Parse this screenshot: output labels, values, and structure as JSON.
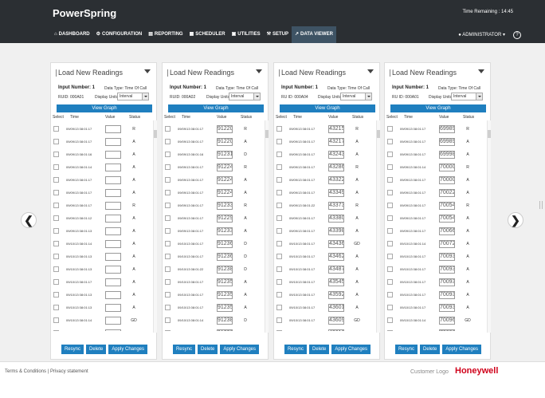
{
  "header": {
    "brand": "PowerSpring",
    "time_remaining": "Time Remaining : 14:45",
    "nav": [
      {
        "label": "DASHBOARD",
        "icon": "home-icon"
      },
      {
        "label": "CONFIGURATION",
        "icon": "gear-icon"
      },
      {
        "label": "REPORTING",
        "icon": "report-icon"
      },
      {
        "label": "SCHEDULER",
        "icon": "calendar-icon"
      },
      {
        "label": "UTILITIES",
        "icon": "briefcase-icon"
      },
      {
        "label": "SETUP",
        "icon": "wrench-icon"
      },
      {
        "label": "DATA VIEWER",
        "icon": "chart-icon"
      }
    ],
    "active_nav": "DATA VIEWER",
    "user": "ADMINISTRATOR",
    "user_caret": "▾"
  },
  "panels": [
    {
      "title": "Load New Readings",
      "input_number_label": "Input Number: 1",
      "data_type": "Data Type: Time Of Call",
      "rtu_id": "RUID: 000A01",
      "display_units_label": "Display Units:",
      "display_units": "Interval",
      "view_graph": "View Graph",
      "headers": {
        "select": "Select",
        "time": "Time",
        "value": "Value",
        "status": "Status"
      },
      "rows": [
        {
          "time": "09/09/13 08:01:17",
          "value": "",
          "status": "R"
        },
        {
          "time": "09/09/13 08:01:17",
          "value": "",
          "status": "A"
        },
        {
          "time": "09/09/13 08:01:16",
          "value": "",
          "status": "A"
        },
        {
          "time": "09/09/13 08:01:14",
          "value": "",
          "status": "A"
        },
        {
          "time": "09/09/13 08:01:17",
          "value": "",
          "status": "A"
        },
        {
          "time": "09/09/13 08:01:17",
          "value": "",
          "status": "A"
        },
        {
          "time": "09/09/13 08:01:17",
          "value": "",
          "status": "R"
        },
        {
          "time": "09/09/13 08:01:12",
          "value": "",
          "status": "A"
        },
        {
          "time": "09/09/13 08:01:13",
          "value": "",
          "status": "A"
        },
        {
          "time": "09/10/13 08:01:14",
          "value": "",
          "status": "A"
        },
        {
          "time": "09/10/13 08:01:13",
          "value": "",
          "status": "A"
        },
        {
          "time": "09/10/13 08:01:13",
          "value": "",
          "status": "A"
        },
        {
          "time": "09/10/13 08:01:17",
          "value": "",
          "status": "A"
        },
        {
          "time": "09/10/13 08:01:13",
          "value": "",
          "status": "A"
        },
        {
          "time": "09/10/13 08:01:13",
          "value": "",
          "status": "A"
        },
        {
          "time": "09/10/13 08:01:14",
          "value": "",
          "status": "GD"
        },
        {
          "time": "09/10/13 08:01:25",
          "value": "",
          "status": "GD"
        },
        {
          "time": "09/10/13 08:01:16",
          "value": "",
          "status": "GD"
        }
      ]
    },
    {
      "title": "Load New Readings",
      "input_number_label": "Input Number: 1",
      "data_type": "Data Type: Time Of Call",
      "rtu_id": "RUID: 000A02",
      "display_units_label": "Display Units:",
      "display_units": "Interval",
      "view_graph": "View Graph",
      "headers": {
        "select": "Select",
        "time": "Time",
        "value": "Value",
        "status": "Status"
      },
      "rows": [
        {
          "time": "09/09/13 08:01:17",
          "value": "912201",
          "status": "R"
        },
        {
          "time": "09/09/13 08:01:17",
          "value": "912201",
          "status": "A"
        },
        {
          "time": "09/09/13 08:01:16",
          "value": "912315",
          "status": "D"
        },
        {
          "time": "09/09/13 08:01:17",
          "value": "912246",
          "status": "R"
        },
        {
          "time": "09/09/13 08:01:17",
          "value": "912246",
          "status": "A"
        },
        {
          "time": "09/09/13 08:01:17",
          "value": "912246",
          "status": "A"
        },
        {
          "time": "09/09/13 08:01:17",
          "value": "912331",
          "status": "R"
        },
        {
          "time": "09/09/13 08:01:17",
          "value": "912291",
          "status": "A"
        },
        {
          "time": "09/09/13 08:01:17",
          "value": "912331",
          "status": "A"
        },
        {
          "time": "09/10/13 08:01:17",
          "value": "912362",
          "status": "D"
        },
        {
          "time": "09/10/13 08:01:17",
          "value": "912362",
          "status": "D"
        },
        {
          "time": "09/10/13 08:01:22",
          "value": "912388",
          "status": "D"
        },
        {
          "time": "09/10/13 08:01:17",
          "value": "912355",
          "status": "A"
        },
        {
          "time": "09/10/13 08:01:17",
          "value": "912355",
          "status": "A"
        },
        {
          "time": "09/10/13 08:01:17",
          "value": "912355",
          "status": "A"
        },
        {
          "time": "09/10/13 08:01:14",
          "value": "912388",
          "status": "D"
        },
        {
          "time": "09/10/13 08:01:16",
          "value": "912388",
          "status": "D"
        },
        {
          "time": "09/10/13 08:01:16",
          "value": "912388",
          "status": "D"
        }
      ]
    },
    {
      "title": "Load New Readings",
      "input_number_label": "Input Number: 1",
      "data_type": "Data Type: Time Of Call",
      "rtu_id": "RU ID: 000A04",
      "display_units_label": "Display Units:",
      "display_units": "Interval",
      "view_graph": "View Graph",
      "headers": {
        "select": "Select",
        "time": "Time",
        "value": "Value",
        "status": "Status"
      },
      "rows": [
        {
          "time": "09/09/13 08:01:17",
          "value": "432154",
          "status": "R"
        },
        {
          "time": "09/09/13 08:01:17",
          "value": "432175",
          "status": "A"
        },
        {
          "time": "09/09/13 08:01:17",
          "value": "432436",
          "status": "A"
        },
        {
          "time": "09/09/13 08:01:17",
          "value": "432862",
          "status": "R"
        },
        {
          "time": "09/09/13 08:01:17",
          "value": "433227",
          "status": "A"
        },
        {
          "time": "09/09/13 08:01:17",
          "value": "433498",
          "status": "A"
        },
        {
          "time": "09/09/13 08:01:22",
          "value": "433730",
          "status": "R"
        },
        {
          "time": "09/09/13 08:01:17",
          "value": "433807",
          "status": "A"
        },
        {
          "time": "09/09/13 08:01:17",
          "value": "433981",
          "status": "A"
        },
        {
          "time": "09/10/13 08:01:17",
          "value": "434365",
          "status": "GD"
        },
        {
          "time": "09/10/13 08:01:17",
          "value": "434624",
          "status": "A"
        },
        {
          "time": "09/10/13 08:01:17",
          "value": "434874",
          "status": "A"
        },
        {
          "time": "09/10/13 08:01:17",
          "value": "435457",
          "status": "A"
        },
        {
          "time": "09/10/13 08:01:17",
          "value": "435925",
          "status": "A"
        },
        {
          "time": "09/10/13 08:01:17",
          "value": "436012",
          "status": "A"
        },
        {
          "time": "09/10/13 08:01:17",
          "value": "436092",
          "status": "GD"
        },
        {
          "time": "09/10/13 08:01:40",
          "value": "436107",
          "status": "GD"
        },
        {
          "time": "09/10/13 08:01:17",
          "value": "436473",
          "status": "GD"
        }
      ]
    },
    {
      "title": "Load New Readings",
      "input_number_label": "Input Number: 1",
      "data_type": "Data Type: Time Of Call",
      "rtu_id": "RU ID: 000A01",
      "display_units_label": "Display Units:",
      "display_units": "Interval",
      "view_graph": "View Graph",
      "headers": {
        "select": "Select",
        "time": "Time",
        "value": "Value",
        "status": "Status"
      },
      "rows": [
        {
          "time": "09/09/13 08:01:17",
          "value": "699892",
          "status": "R"
        },
        {
          "time": "09/09/13 08:01:17",
          "value": "699892",
          "status": "A"
        },
        {
          "time": "09/09/13 08:01:17",
          "value": "699985",
          "status": "A"
        },
        {
          "time": "09/09/13 08:01:14",
          "value": "700007",
          "status": "R"
        },
        {
          "time": "09/09/13 08:01:17",
          "value": "700008",
          "status": "A"
        },
        {
          "time": "09/09/13 08:01:17",
          "value": "700222",
          "status": "A"
        },
        {
          "time": "09/09/13 08:01:17",
          "value": "700542",
          "status": "R"
        },
        {
          "time": "09/09/13 08:01:17",
          "value": "700542",
          "status": "A"
        },
        {
          "time": "09/09/13 08:01:17",
          "value": "700668",
          "status": "A"
        },
        {
          "time": "09/10/13 08:01:14",
          "value": "700720",
          "status": "A"
        },
        {
          "time": "09/10/13 08:01:17",
          "value": "700935",
          "status": "A"
        },
        {
          "time": "09/10/13 08:01:17",
          "value": "700935",
          "status": "A"
        },
        {
          "time": "09/10/13 08:01:17",
          "value": "700936",
          "status": "A"
        },
        {
          "time": "09/10/13 08:01:17",
          "value": "700936",
          "status": "A"
        },
        {
          "time": "09/10/13 08:01:17",
          "value": "700936",
          "status": "A"
        },
        {
          "time": "09/10/13 08:01:14",
          "value": "700961",
          "status": "GD"
        },
        {
          "time": "09/10/13 08:01:17",
          "value": "700970",
          "status": "GD"
        },
        {
          "time": "09/10/13 08:01:16",
          "value": "701002",
          "status": "GD"
        }
      ]
    }
  ],
  "actions": {
    "resync": "Resync",
    "delete": "Delete",
    "apply": "Apply Changes"
  },
  "carousel": {
    "prev": "❮",
    "next": "❯"
  },
  "footer": {
    "terms": "Terms & Conditions",
    "separator": "|",
    "privacy": "Privacy statement",
    "customer_logo": "Customer Logo",
    "logo_text": "Honeywell"
  },
  "colors": {
    "header_bg": "#2b2f33",
    "accent": "#1f7fbf",
    "logo": "#d0021b"
  }
}
